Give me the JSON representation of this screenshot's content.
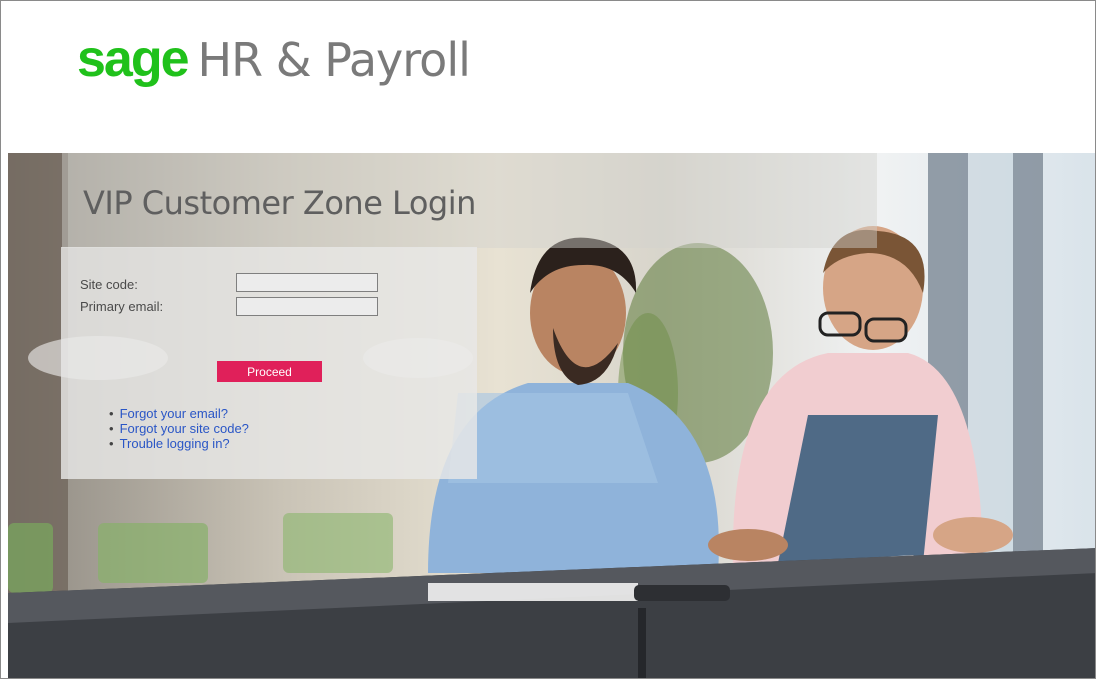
{
  "brand": {
    "logo_sage": "sage",
    "logo_product": "HR & Payroll",
    "logo_color": "#20c11b"
  },
  "login": {
    "title": "VIP Customer Zone Login",
    "site_code_label": "Site code:",
    "site_code_value": "",
    "primary_email_label": "Primary email:",
    "primary_email_value": "",
    "proceed_label": "Proceed",
    "proceed_color": "#e0205a"
  },
  "help_links": [
    {
      "label": "Forgot your email?"
    },
    {
      "label": "Forgot your site code?"
    },
    {
      "label": "Trouble logging in?"
    }
  ],
  "hero_image": {
    "subject": "two-men-with-laptop-photo"
  }
}
